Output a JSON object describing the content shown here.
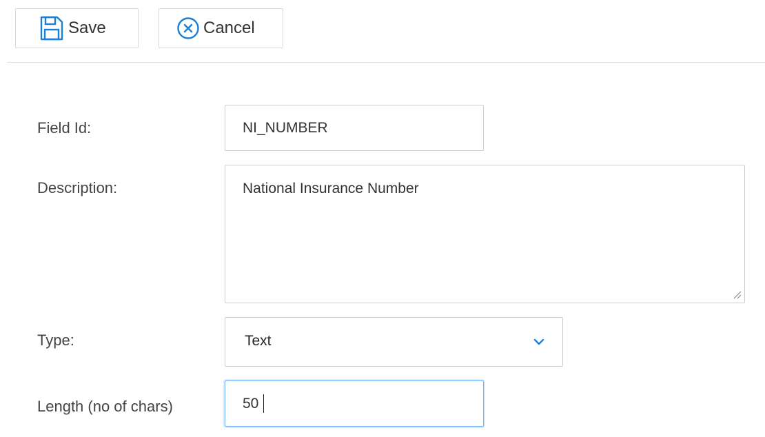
{
  "toolbar": {
    "save_label": "Save",
    "cancel_label": "Cancel",
    "save_icon": "floppy-disk-icon",
    "cancel_icon": "circle-x-icon",
    "accent_color": "#1a7fd6"
  },
  "form": {
    "field_id": {
      "label": "Field Id:",
      "value": "NI_NUMBER"
    },
    "description": {
      "label": "Description:",
      "value": "National Insurance Number"
    },
    "type": {
      "label": "Type:",
      "selected": "Text",
      "icon": "chevron-down-icon"
    },
    "length": {
      "label": "Length (no of chars)",
      "value": "50",
      "focus_border_color": "#74b1f4"
    }
  }
}
